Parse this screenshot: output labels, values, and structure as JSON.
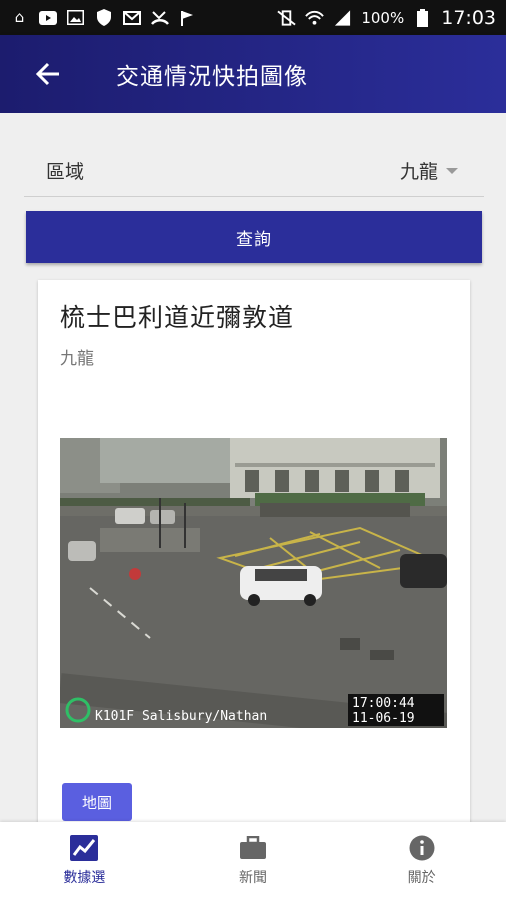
{
  "status_bar": {
    "left_icons": [
      "home-icon",
      "youtube-icon",
      "image-icon",
      "shield-icon",
      "mail-icon",
      "missed-call-icon",
      "flag-icon"
    ],
    "battery": "100%",
    "time": "17:03"
  },
  "app_bar": {
    "title": "交通情況快拍圖像"
  },
  "filter": {
    "region_label": "區域",
    "region_value": "九龍",
    "query_label": "查詢"
  },
  "card": {
    "title": "梳士巴利道近彌敦道",
    "subtitle": "九龍",
    "camera_caption": "K101F Salisbury/Nathan",
    "camera_time": "17:00:44",
    "camera_date": "11-06-19",
    "map_label": "地圖"
  },
  "bottom_nav": {
    "items": [
      {
        "label": "數據選",
        "icon": "chart-icon",
        "active": true
      },
      {
        "label": "新聞",
        "icon": "briefcase-icon",
        "active": false
      },
      {
        "label": "關於",
        "icon": "info-icon",
        "active": false
      }
    ]
  },
  "colors": {
    "primary": "#2b2e9a",
    "app_bar_dark": "#1c1c6e",
    "map_button": "#5a5fe0"
  }
}
